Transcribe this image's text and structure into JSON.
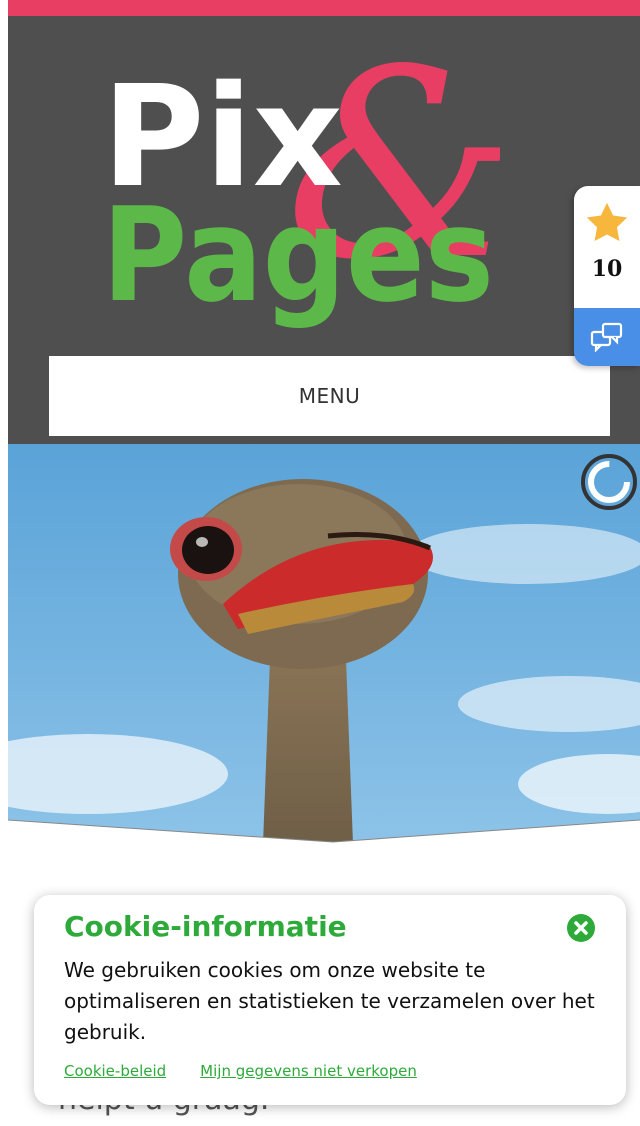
{
  "brand": {
    "logo_line1": "Pix",
    "logo_ampersand": "&",
    "logo_line2": "Pages",
    "colors": {
      "pink": "#e83e64",
      "green": "#5cb949",
      "header_bg": "#4f4f4f"
    }
  },
  "header": {
    "menu_label": "MENU"
  },
  "rating_widget": {
    "star_icon": "star-icon",
    "count": "10",
    "feedback_icon": "chat-bubbles-icon"
  },
  "hero": {
    "image": "ostrich-head-photo",
    "slider_icon": "slider-progress-icon"
  },
  "content": {
    "text_partial": "helpt u graag."
  },
  "cookie_banner": {
    "title": "Cookie-informatie",
    "text": "We gebruiken cookies om onze website te optimaliseren en statistieken te verzamelen over het gebruik.",
    "links": [
      "Cookie-beleid",
      "Mijn gegevens niet verkopen"
    ],
    "close_icon": "close-circle-icon",
    "accent_color": "#2eaa3a"
  }
}
